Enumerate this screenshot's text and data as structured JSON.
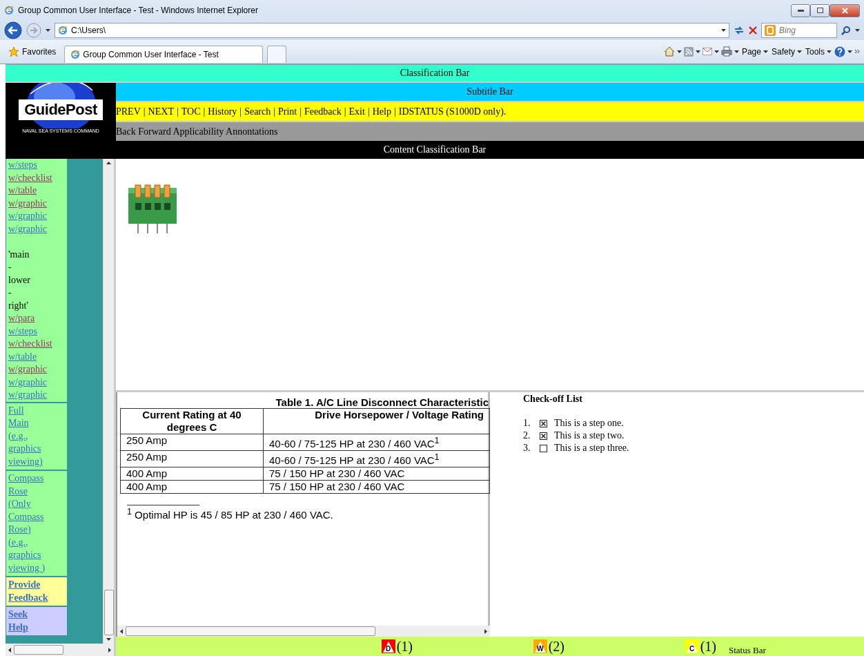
{
  "window": {
    "title": "Group Common User Interface - Test - Windows Internet Explorer"
  },
  "address_bar": {
    "url": "C:\\Users\\"
  },
  "search_field": {
    "placeholder": "Bing"
  },
  "favorites_bar": {
    "favorites": "Favorites",
    "tabs": [
      {
        "label": "Group Common User Interface - Test",
        "selected": true
      }
    ]
  },
  "command_bar": {
    "menus": [
      "Page",
      "Safety",
      "Tools"
    ]
  },
  "classification_bar": "Classification Bar",
  "logo": {
    "title": "GuidePost",
    "subtitle": "NAVAL SEA SYSTEMS COMMAND"
  },
  "subtitle_bar": "Subtitle Bar",
  "nav_bar": {
    "separator": "|",
    "links": [
      "PREV",
      "NEXT",
      "TOC",
      "History",
      "Search",
      "Print",
      "Feedback",
      "Exit",
      "Help",
      "IDSTATUS (S1000D only)."
    ]
  },
  "annotation_bar": "Back Forward Applicability Annontations",
  "content_classification_bar": "Content Classification Bar",
  "sidebar": {
    "items": [
      {
        "kind": "link",
        "text": "w/steps",
        "visited": false
      },
      {
        "kind": "link",
        "text": "w/checklist",
        "visited": true
      },
      {
        "kind": "link",
        "text": "w/table",
        "visited": true
      },
      {
        "kind": "link",
        "text": "w/graphic",
        "visited": true
      },
      {
        "kind": "link",
        "text": "w/graphic",
        "visited": false
      },
      {
        "kind": "link",
        "text": "w/graphic",
        "visited": false
      },
      {
        "kind": "blank"
      },
      {
        "kind": "text",
        "text": "'main"
      },
      {
        "kind": "text",
        "text": "-"
      },
      {
        "kind": "text",
        "text": "lower"
      },
      {
        "kind": "text",
        "text": "-"
      },
      {
        "kind": "text",
        "text": "right'"
      },
      {
        "kind": "link",
        "text": "w/para",
        "visited": true
      },
      {
        "kind": "link",
        "text": "w/steps",
        "visited": false
      },
      {
        "kind": "link",
        "text": "w/checklist",
        "visited": true
      },
      {
        "kind": "link",
        "text": "w/table",
        "visited": false
      },
      {
        "kind": "link",
        "text": "w/graphic",
        "visited": true
      },
      {
        "kind": "link",
        "text": "w/graphic",
        "visited": false
      },
      {
        "kind": "link",
        "text": "w/graphic",
        "visited": false
      }
    ],
    "panels": [
      {
        "text": "Full Main (e.g., graphics viewing)",
        "color": "#99ff99",
        "bold": false
      },
      {
        "text": "Compass Rose (Only Compass Rose) (e.g., graphics viewing )",
        "color": "#99ff99",
        "bold": false
      },
      {
        "text": "Provide Feedback",
        "color": "#ffff99",
        "bold": true
      },
      {
        "text": "Seek Help",
        "color": "#ccccff",
        "bold": true
      }
    ]
  },
  "table": {
    "title": "Table 1.  A/C Line Disconnect Characteristic",
    "columns": [
      "Current Rating at 40 degrees C",
      "Drive Horsepower / Voltage Rating"
    ],
    "rows": [
      [
        "250 Amp",
        "40-60 / 75-125 HP at 230 / 460 VAC$^{1}$"
      ],
      [
        "250 Amp",
        "40-60 / 75-125 HP at 230 / 460 VAC$^{1}$"
      ],
      [
        "400 Amp",
        "75 / 150 HP at 230 / 460 VAC"
      ],
      [
        "400 Amp",
        "75 / 150 HP at 230 / 460 VAC"
      ]
    ],
    "footnote": "$^{1}$ Optimal HP is 45 / 85 HP at 230 / 460 VAC."
  },
  "checklist": {
    "title": "Check-off List",
    "items": [
      {
        "number": "1.",
        "text": "This is a step one.",
        "checked": true
      },
      {
        "number": "2.",
        "text": "This is a step two.",
        "checked": true
      },
      {
        "number": "3.",
        "text": "This is a step three.",
        "checked": false
      }
    ]
  },
  "status_bar": {
    "alerts": [
      {
        "letter": "D",
        "count": "(1)",
        "color": "#ff0000"
      },
      {
        "letter": "W",
        "count": "(2)",
        "color": "#ffaa00"
      },
      {
        "letter": "C",
        "count": "(1)",
        "color": "#ffff00"
      }
    ],
    "label": "Status Bar"
  }
}
